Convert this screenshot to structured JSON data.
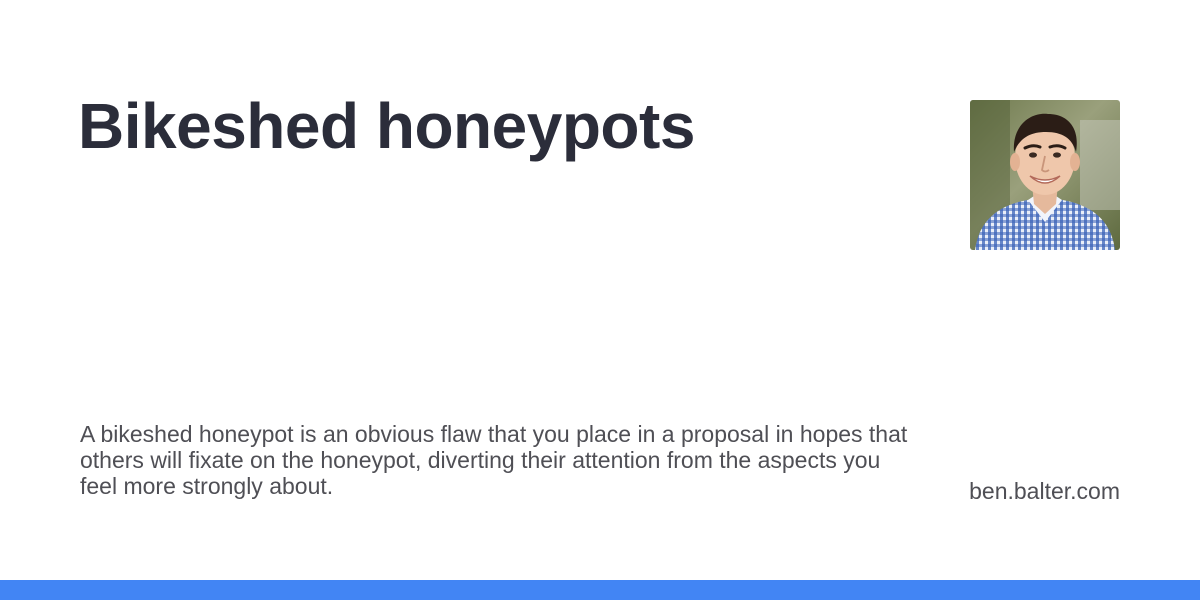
{
  "title": "Bikeshed honeypots",
  "description": "A bikeshed honeypot is an obvious flaw that you place in a proposal in hopes that others will fixate on the honeypot, diverting their attention from the aspects you feel more strongly about.",
  "site": "ben.balter.com",
  "colors": {
    "accent_bar": "#4285f4",
    "title_text": "#2b2d3a",
    "body_text": "#4f4f55",
    "background": "#ffffff"
  }
}
